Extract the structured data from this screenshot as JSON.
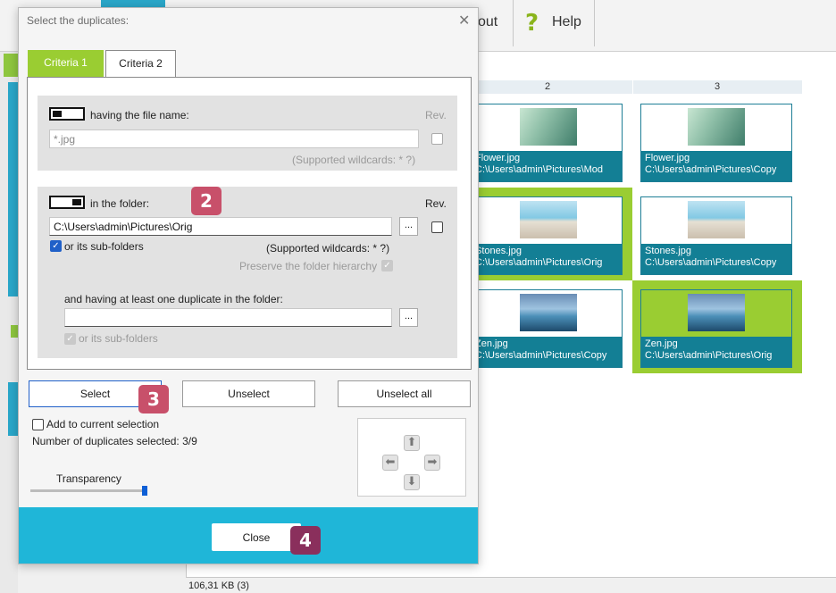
{
  "toolbar": {
    "about_label": "out",
    "help_icon": "?",
    "help_label": "Help"
  },
  "grid": {
    "columns": [
      "2",
      "3"
    ],
    "rows": [
      [
        {
          "name": "Flower.jpg",
          "path": "C:\\Users\\admin\\Pictures\\Mod",
          "selected": false
        },
        {
          "name": "Flower.jpg",
          "path": "C:\\Users\\admin\\Pictures\\Copy",
          "selected": false
        }
      ],
      [
        {
          "name": "Stones.jpg",
          "path": "C:\\Users\\admin\\Pictures\\Orig",
          "selected": true
        },
        {
          "name": "Stones.jpg",
          "path": "C:\\Users\\admin\\Pictures\\Copy",
          "selected": false
        }
      ],
      [
        {
          "name": "Zen.jpg",
          "path": "C:\\Users\\admin\\Pictures\\Copy",
          "selected": false
        },
        {
          "name": "Zen.jpg",
          "path": "C:\\Users\\admin\\Pictures\\Orig",
          "selected": true
        }
      ]
    ]
  },
  "status_bar": {
    "text": "106,31 KB (3)"
  },
  "dialog": {
    "title": "Select the duplicates:",
    "close_glyph": "✕",
    "tabs": [
      "Criteria 1",
      "Criteria 2"
    ],
    "filename_group": {
      "label": "having the file name:",
      "rev_label": "Rev.",
      "value": "*.jpg",
      "wildcards_note": "(Supported wildcards: * ?)"
    },
    "folder_group": {
      "label": "in the folder:",
      "rev_label": "Rev.",
      "value": "C:\\Users\\admin\\Pictures\\Orig",
      "browse_label": "...",
      "subfolders_label": "or its sub-folders",
      "subfolders_checked": true,
      "wildcards_note": "(Supported wildcards: * ?)",
      "preserve_label": "Preserve the folder hierarchy",
      "duplicate_folder_label": "and having at least one duplicate in the folder:",
      "duplicate_folder_value": "",
      "duplicate_browse_label": "...",
      "duplicate_subfolders_label": "or its sub-folders"
    },
    "buttons": {
      "select": "Select",
      "unselect": "Unselect",
      "unselect_all": "Unselect all"
    },
    "add_to_selection_label": "Add to current selection",
    "count_text": "Number of duplicates selected: 3/9",
    "transparency_label": "Transparency",
    "transparency_level": 1.0,
    "nav_arrows": {
      "up": "⬆",
      "left": "⬅",
      "right": "➡",
      "down": "⬇"
    },
    "close_button": "Close"
  },
  "badges": {
    "b2": "2",
    "b3": "3",
    "b4": "4"
  },
  "colors": {
    "accent_green": "#9acd32",
    "accent_blue": "#1fb6d8",
    "caption_teal": "#137f95",
    "badge_pink": "#c8506a",
    "badge_plum": "#8a2f5c"
  }
}
